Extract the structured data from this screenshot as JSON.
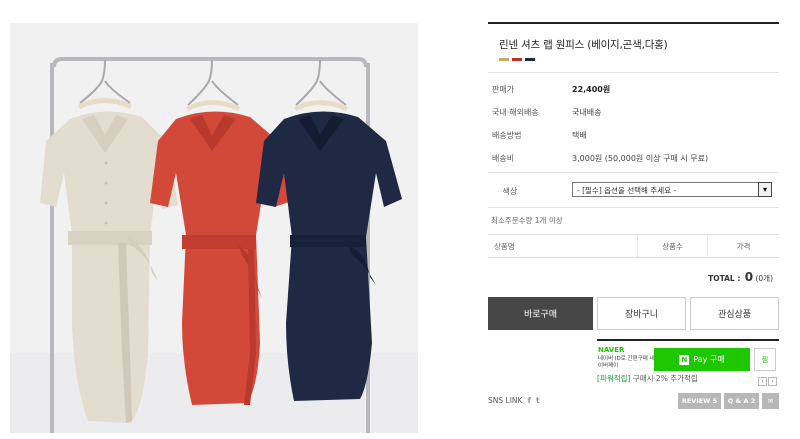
{
  "product": {
    "title": "린넨 셔츠 랩 원피스 (베이지,곤색,다홍)",
    "swatches": [
      "#c9a869",
      "#c0302a",
      "#1f2a4a"
    ]
  },
  "specs": [
    {
      "label": "판매가",
      "value": "22,400원",
      "bold": true
    },
    {
      "label": "국내·해외배송",
      "value": "국내배송",
      "bold": false
    },
    {
      "label": "배송방법",
      "value": "택배",
      "bold": false
    },
    {
      "label": "배송비",
      "value": "3,000원 (50,000원 이상 구매 시 무료)",
      "bold": false
    }
  ],
  "option": {
    "label": "색상",
    "selected": "- [필수] 옵션을 선택해 주세요 -"
  },
  "min_qty": "최소주문수량 1개 이상",
  "table": {
    "col1": "상품명",
    "col2": "상품수",
    "col3": "가격"
  },
  "total": {
    "label": "TOTAL :",
    "amount": "0",
    "count": "(0개)"
  },
  "buttons": {
    "buy": "바로구매",
    "cart": "장바구니",
    "wish": "관심상품"
  },
  "naver": {
    "brand": "NAVER",
    "desc": "네이버 ID로 간편구매 네이버페이",
    "pay": "Pay 구매",
    "pay_n": "N",
    "zzim": "찜"
  },
  "points": {
    "tag": "[파워적립]",
    "text": "구매시 2% 추가적립"
  },
  "bottom": {
    "sns_label": "SNS LINK",
    "review": "REVIEW 5",
    "qna": "Q & A 2"
  }
}
